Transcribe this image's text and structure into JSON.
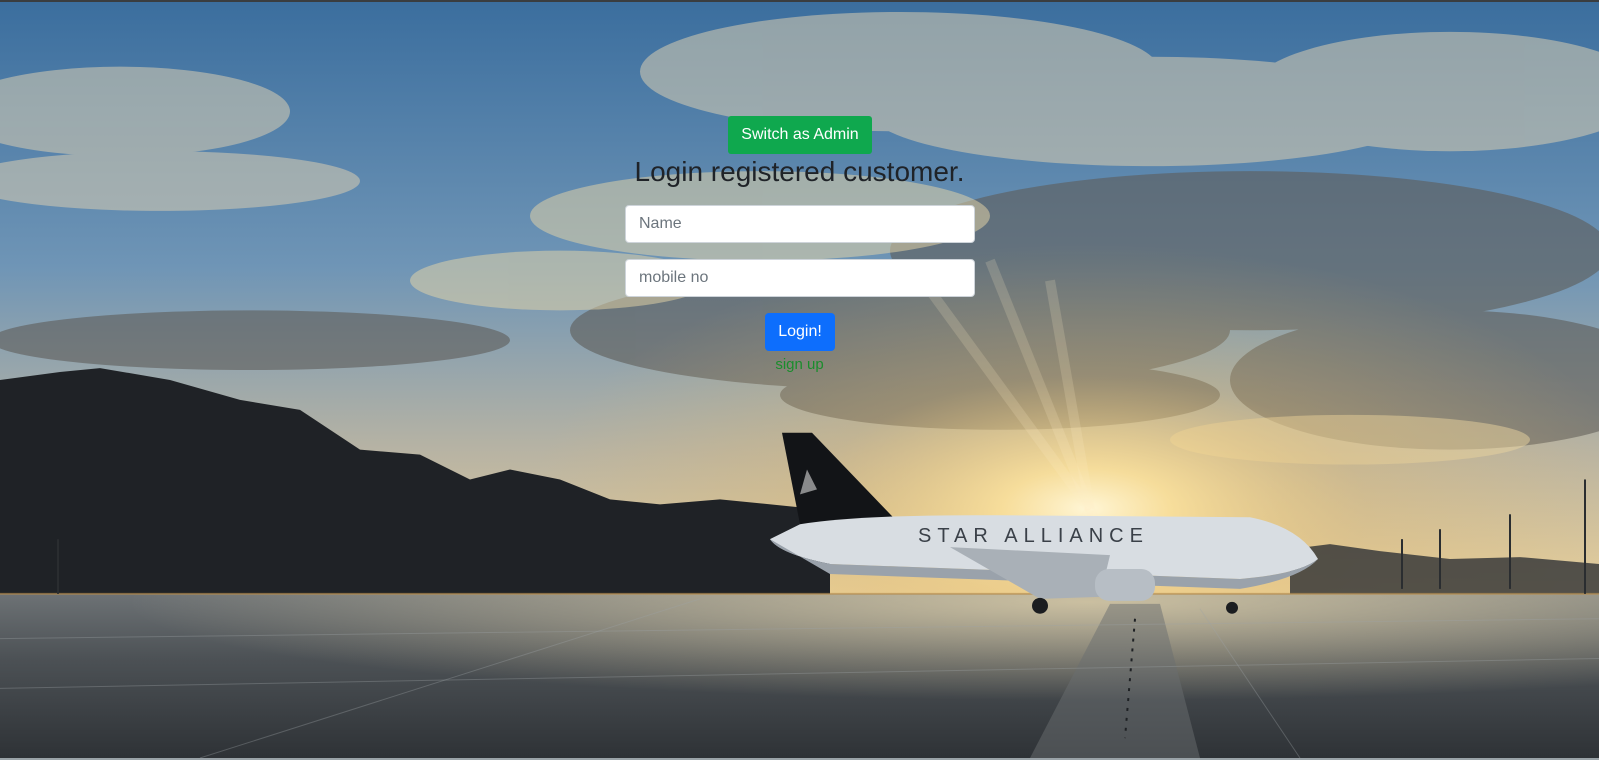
{
  "header": {
    "admin_button_label": "Switch as Admin",
    "title": "Login registered customer."
  },
  "form": {
    "name_placeholder": "Name",
    "name_value": "",
    "mobile_placeholder": "mobile no",
    "mobile_value": "",
    "login_label": "Login!",
    "signup_label": "sign up"
  },
  "background": {
    "scene": "airport-sunset-airplane",
    "airplane_livery_text": "STAR ALLIANCE"
  },
  "colors": {
    "admin_button": "#0fa84e",
    "login_button": "#0d6efd",
    "signup_link": "#1a8d2c",
    "title_text": "#1f2328"
  }
}
